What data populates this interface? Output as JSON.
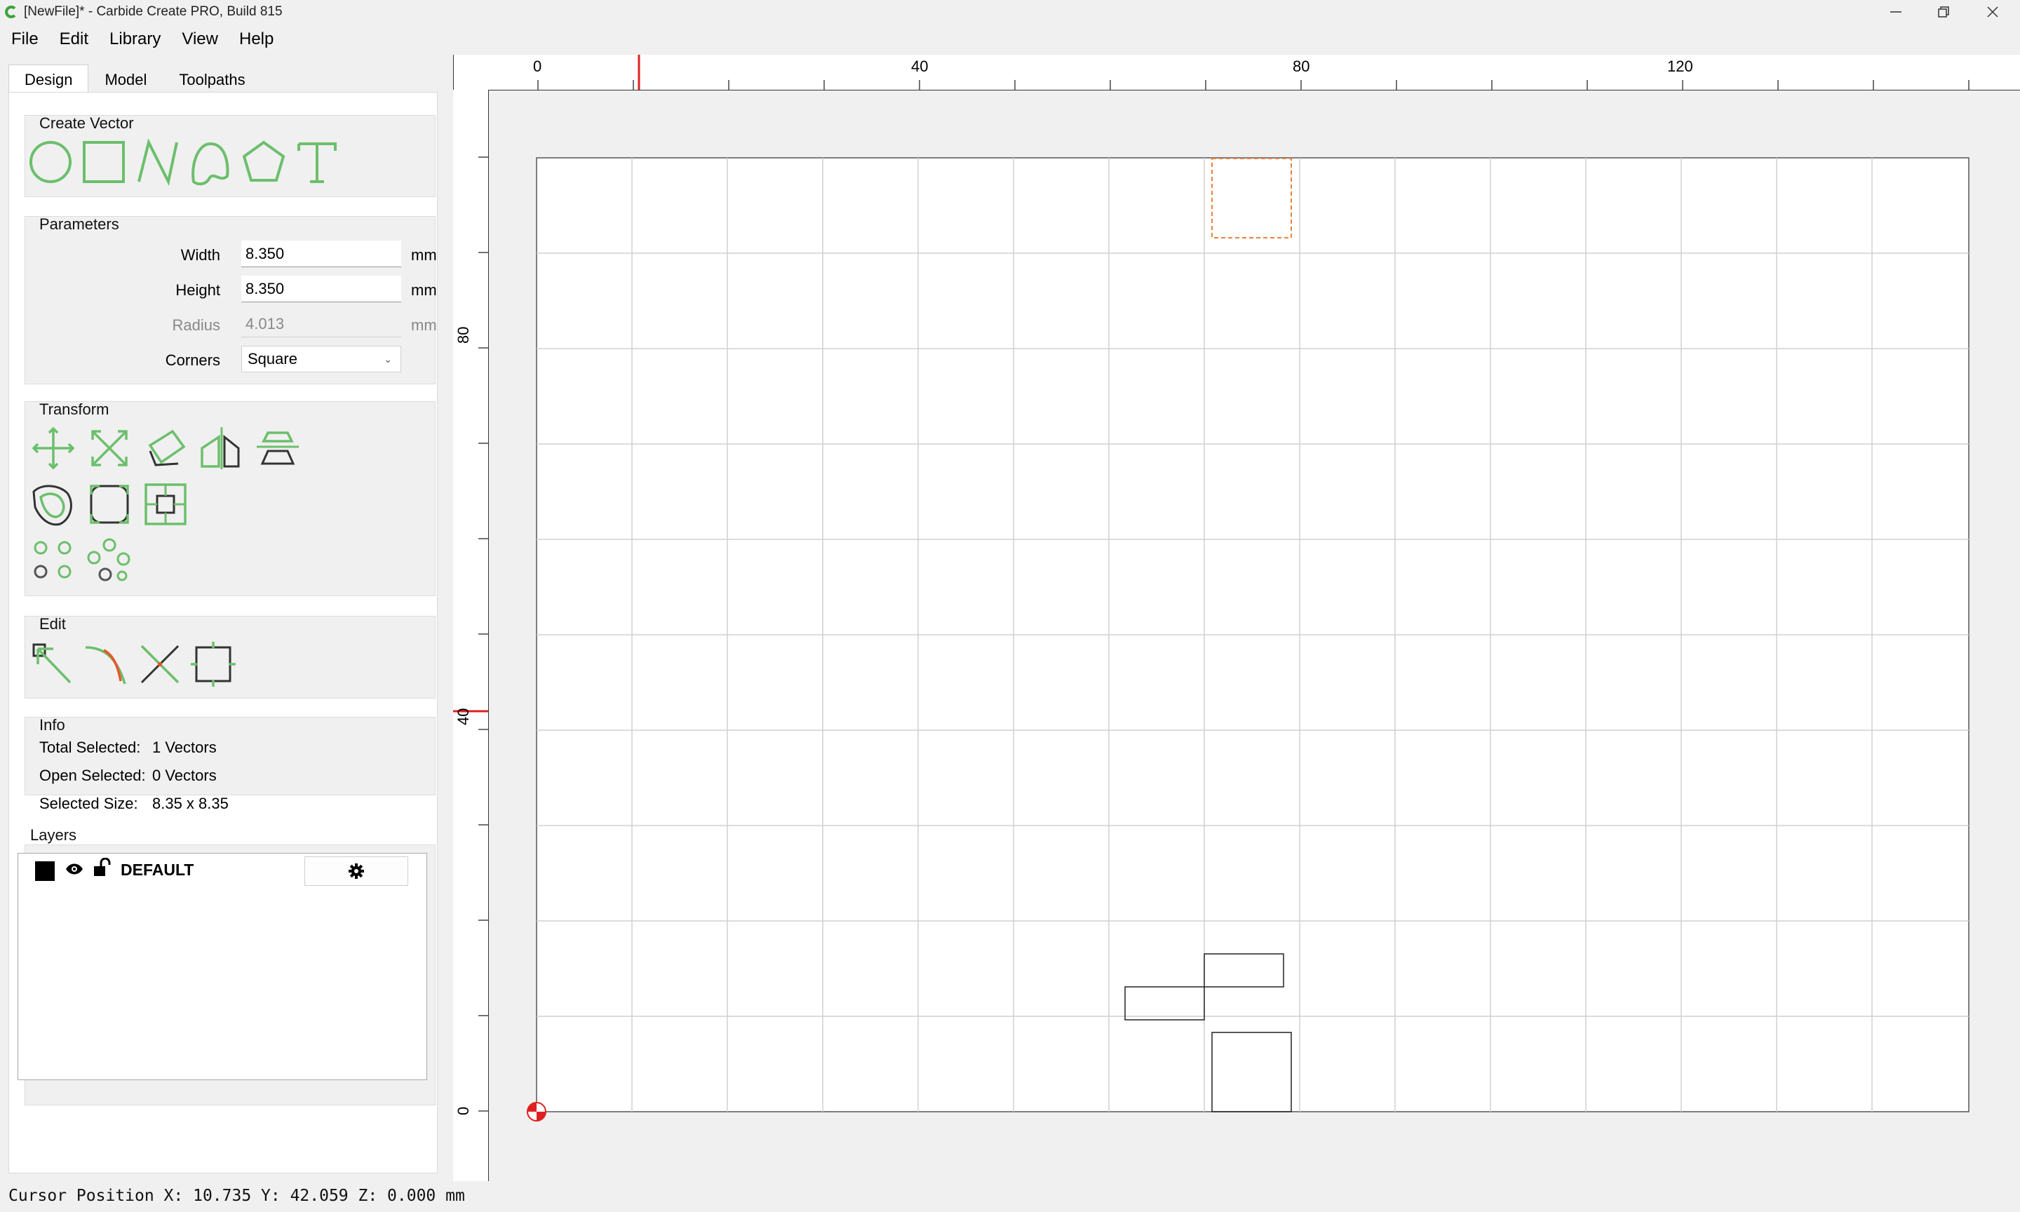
{
  "window": {
    "title": "[NewFile]* - Carbide Create PRO, Build 815"
  },
  "menu": [
    "File",
    "Edit",
    "Library",
    "View",
    "Help"
  ],
  "tabs": [
    "Design",
    "Model",
    "Toolpaths"
  ],
  "create_vector": {
    "title": "Create Vector",
    "icons": [
      "circle-icon",
      "rectangle-icon",
      "polyline-icon",
      "curve-icon",
      "polygon-icon",
      "text-icon"
    ]
  },
  "parameters": {
    "title": "Parameters",
    "width_label": "Width",
    "width_value": "8.350",
    "width_unit": "mm",
    "height_label": "Height",
    "height_value": "8.350",
    "height_unit": "mm",
    "radius_label": "Radius",
    "radius_value": "4.013",
    "radius_unit": "mm",
    "corners_label": "Corners",
    "corners_value": "Square"
  },
  "transform": {
    "title": "Transform",
    "icons": [
      "move-icon",
      "scale-icon",
      "rotate-icon",
      "mirror-icon",
      "align-icon",
      "offset-icon",
      "fillet-icon",
      "center-snap-icon",
      "circular-array-icon",
      "pattern-array-icon"
    ]
  },
  "edit": {
    "title": "Edit",
    "icons": [
      "node-edit-icon",
      "trim-curve-icon",
      "split-icon",
      "boundary-box-icon"
    ]
  },
  "info": {
    "title": "Info",
    "total_selected_label": "Total Selected:",
    "total_selected_value": "1 Vectors",
    "open_selected_label": "Open Selected:",
    "open_selected_value": "0 Vectors",
    "selected_size_label": "Selected Size:",
    "selected_size_value": "8.35 x 8.35"
  },
  "layers": {
    "title": "Layers",
    "items": [
      {
        "name": "DEFAULT",
        "color": "#000000"
      }
    ]
  },
  "rulers": {
    "top_labels": [
      "0",
      "40",
      "80",
      "120"
    ],
    "left_labels": [
      "80",
      "40",
      "0"
    ]
  },
  "status": {
    "cursor": "Cursor Position X: 10.735 Y: 42.059 Z: 0.000 mm"
  },
  "colors": {
    "accent_green": "#6cbf6c",
    "selection_orange": "#e8823c",
    "ruler_marker": "#e02020"
  }
}
